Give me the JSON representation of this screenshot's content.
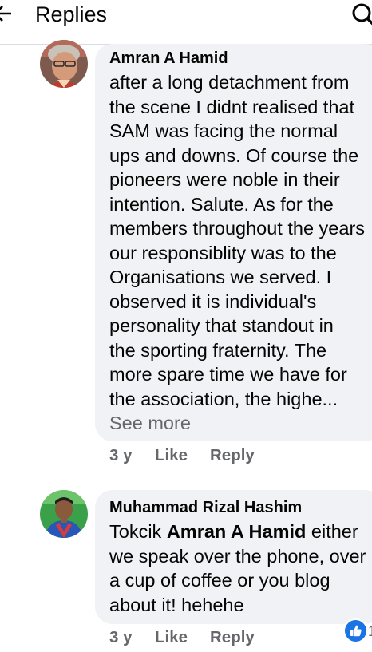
{
  "header": {
    "title": "Replies"
  },
  "comments": [
    {
      "author": "Amran A Hamid",
      "lines": [
        "after a long detachment from",
        "the scene I didnt realised that",
        "SAM was facing the normal",
        "ups and downs. Of course the",
        "pioneers were noble in their",
        "intention. Salute. As for the",
        "members throughout the years",
        "our responsiblity was to the",
        "Organisations we served. I",
        "observed it is individual's",
        "personality that standout in",
        "the sporting fraternity. The",
        "more spare time we have for",
        "the association, the highe..."
      ],
      "see_more": "See more",
      "time": "3 y",
      "like": "Like",
      "reply": "Reply"
    },
    {
      "author": "Muhammad Rizal Hashim",
      "line1_prefix": "Tokcik ",
      "mention": "Amran A Hamid",
      "line1_suffix": " either",
      "lines": [
        "we speak over the phone, over",
        "a cup of coffee or you blog",
        "about it! hehehe"
      ],
      "time": "3 y",
      "like": "Like",
      "reply": "Reply",
      "reaction_count": "1"
    }
  ]
}
